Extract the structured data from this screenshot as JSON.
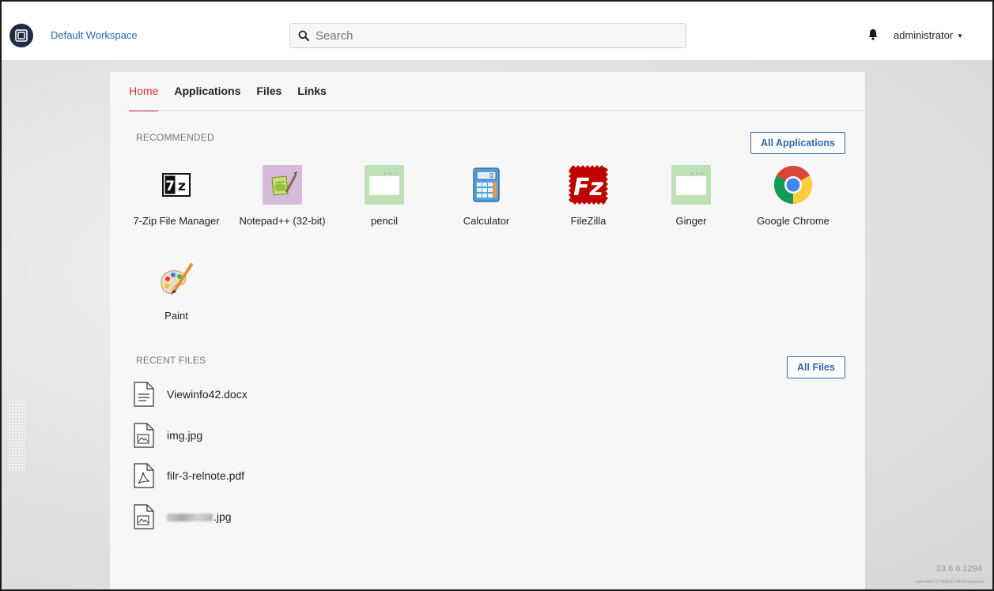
{
  "header": {
    "workspace_name": "Default Workspace",
    "search_placeholder": "Search",
    "username": "administrator"
  },
  "tabs": [
    {
      "label": "Home",
      "active": true
    },
    {
      "label": "Applications",
      "active": false
    },
    {
      "label": "Files",
      "active": false
    },
    {
      "label": "Links",
      "active": false
    }
  ],
  "recommended": {
    "title": "RECOMMENDED",
    "all_button": "All Applications",
    "apps": [
      {
        "label": "7-Zip File Manager",
        "icon": "7zip-icon"
      },
      {
        "label": "Notepad++ (32-bit)",
        "icon": "notepad-plus-plus-icon"
      },
      {
        "label": "pencil",
        "icon": "generic-app-icon"
      },
      {
        "label": "Calculator",
        "icon": "calculator-icon"
      },
      {
        "label": "FileZilla",
        "icon": "filezilla-icon"
      },
      {
        "label": "Ginger",
        "icon": "generic-app-icon"
      },
      {
        "label": "Google Chrome",
        "icon": "chrome-icon"
      },
      {
        "label": "Paint",
        "icon": "paint-icon"
      }
    ]
  },
  "recent_files": {
    "title": "RECENT FILES",
    "all_button": "All Files",
    "files": [
      {
        "name": "Viewinfo42.docx",
        "icon": "document-icon"
      },
      {
        "name": "img.jpg",
        "icon": "image-file-icon"
      },
      {
        "name": "filr-3-relnote.pdf",
        "icon": "pdf-file-icon"
      },
      {
        "name": ".jpg",
        "icon": "image-file-icon",
        "redacted": true
      }
    ]
  },
  "footer": {
    "version": "23.6.6.1294",
    "brand": "opentext | Hybrid Workspaces"
  },
  "colors": {
    "accent": "#2f67b1",
    "active_tab": "#d63031"
  }
}
